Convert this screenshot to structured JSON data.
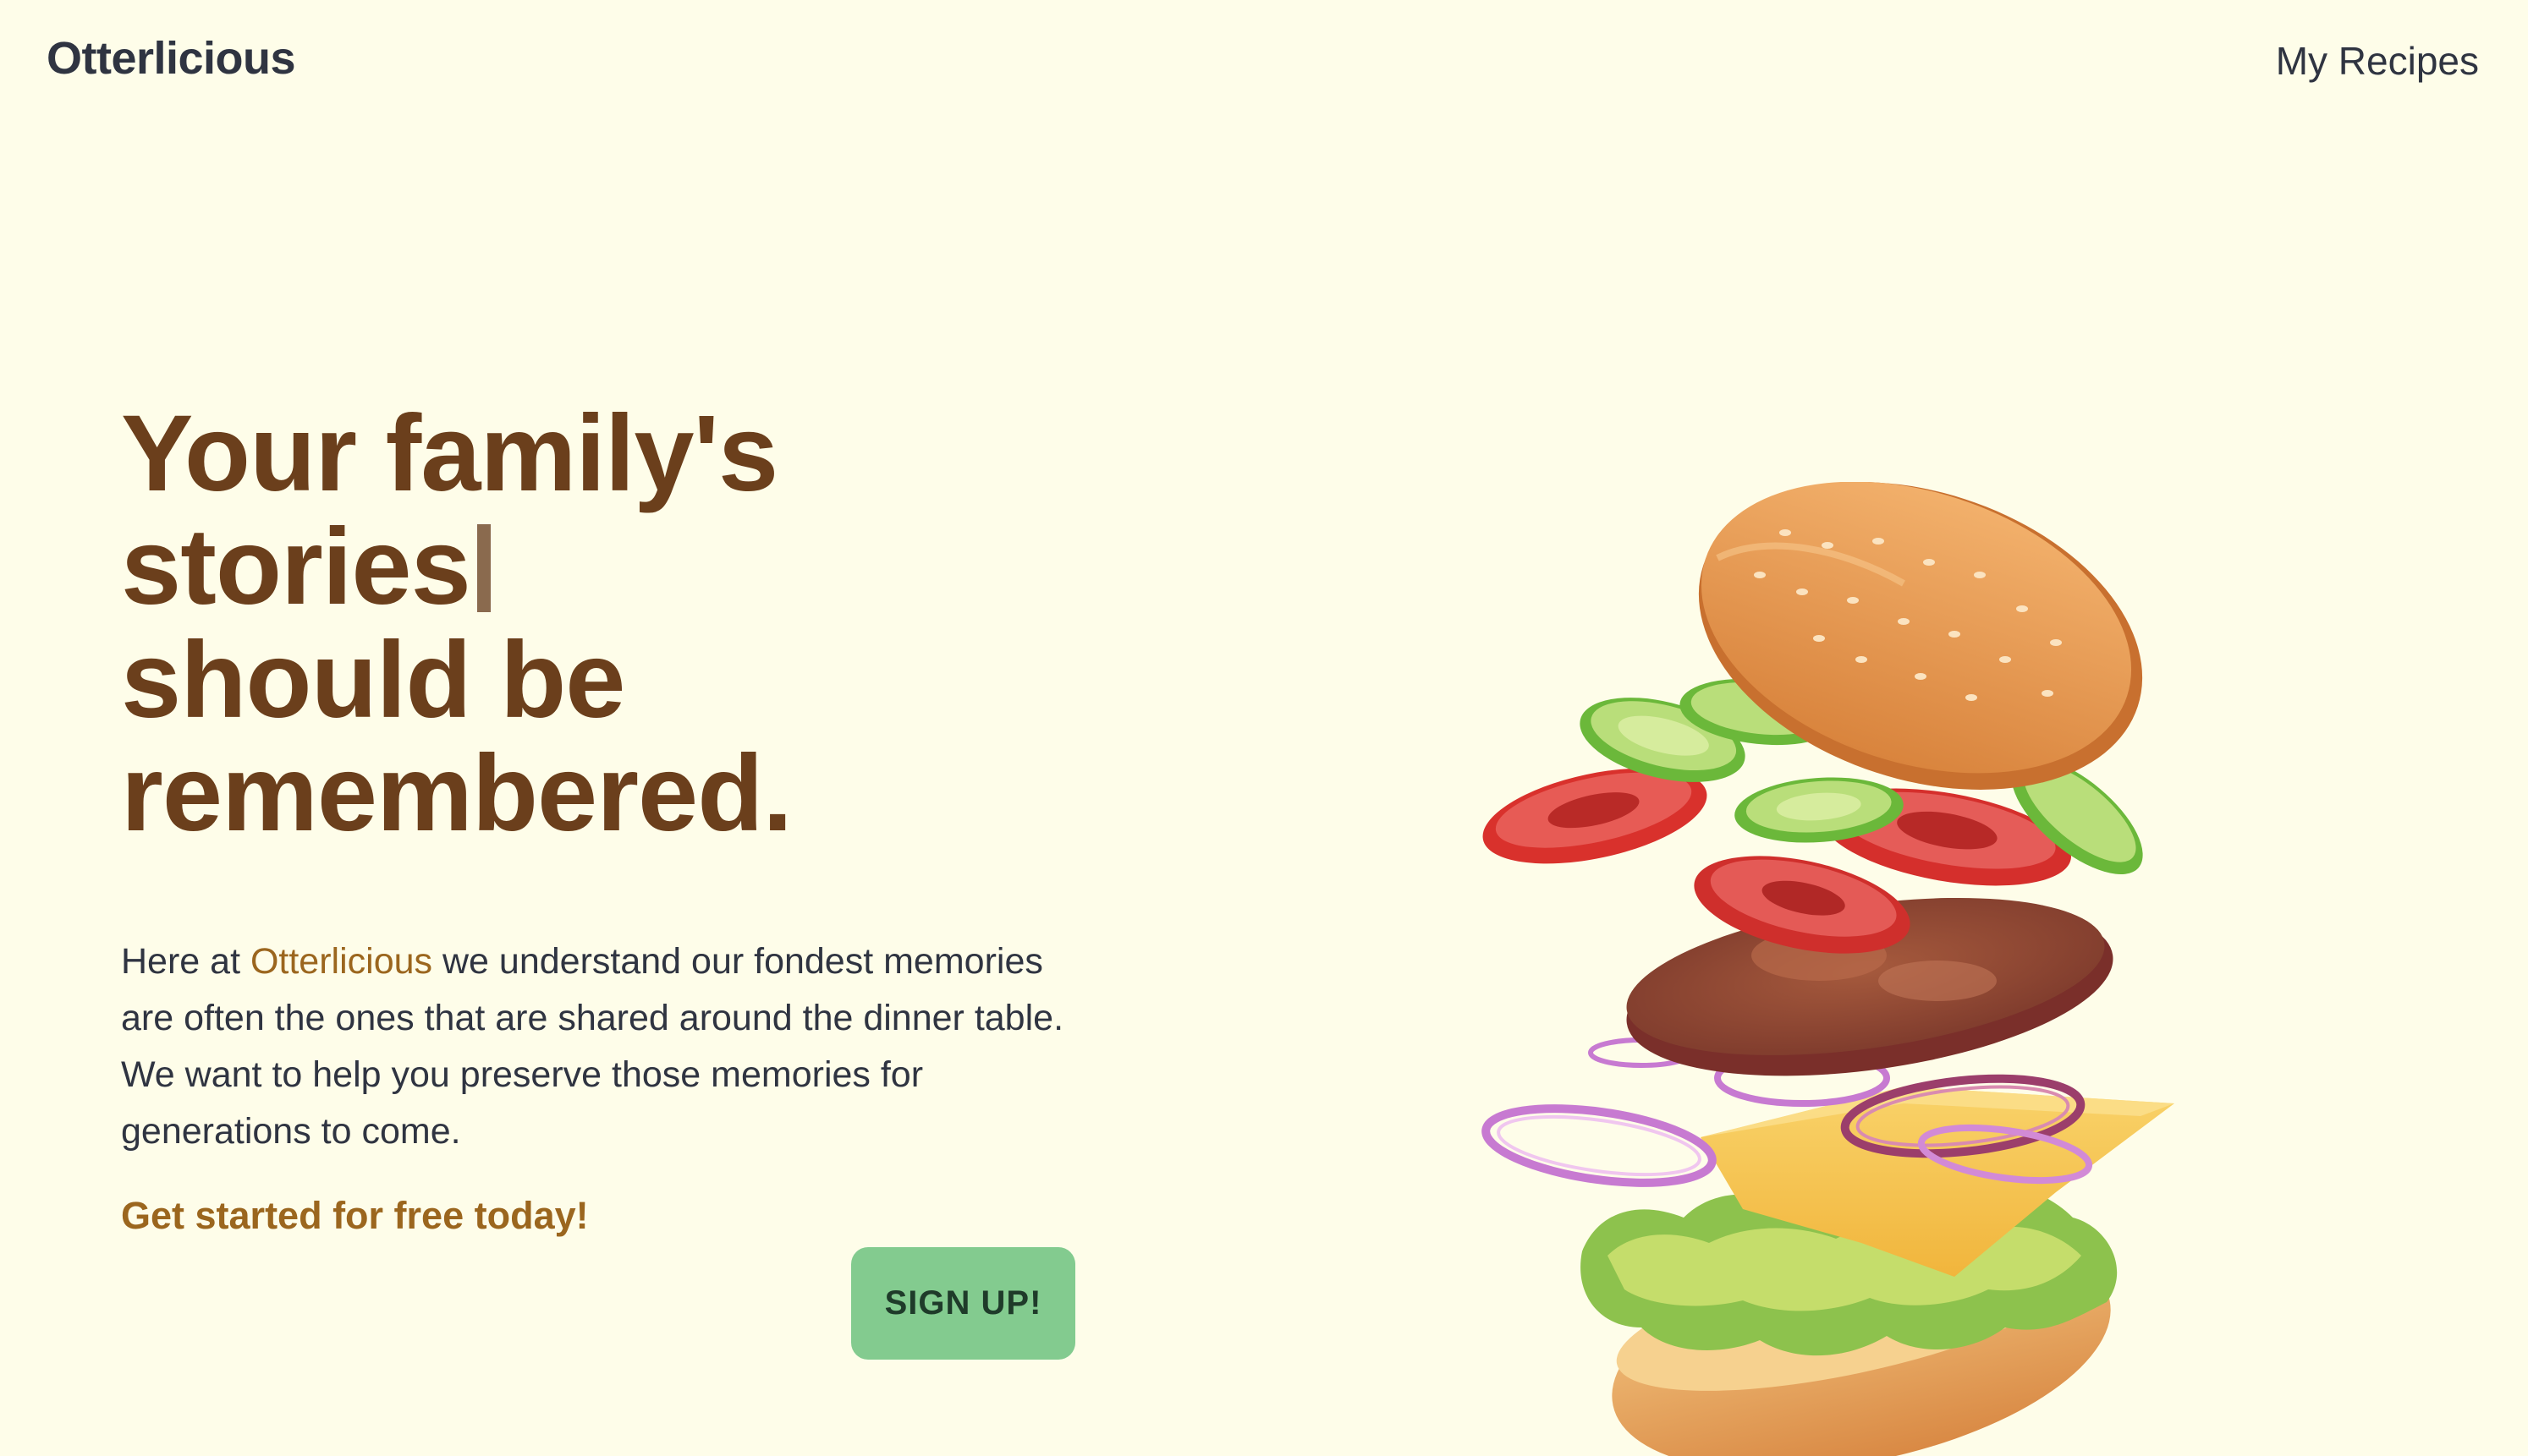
{
  "header": {
    "brand": "Otterlicious",
    "nav_link": "My Recipes"
  },
  "hero": {
    "headline_lines": [
      "Your family's",
      "stories",
      "should be",
      "remembered."
    ],
    "intro_before": "Here at ",
    "intro_accent": "Otterlicious",
    "intro_after": " we understand our fondest memories are often the ones that are shared around the dinner table. We want to help you preserve those memories for generations to come.",
    "cta_text": "Get started for free today!",
    "signup_label": "SIGN UP!"
  },
  "illustration": {
    "icon": "burger-illustration"
  },
  "colors": {
    "background": "#fefde9",
    "headline": "#6b3f1c",
    "accent": "#9b661e",
    "button": "#83cb8f",
    "text": "#2f3441"
  }
}
